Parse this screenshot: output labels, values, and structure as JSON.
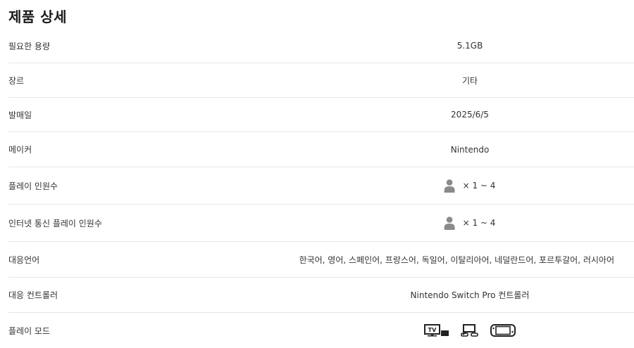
{
  "page": {
    "title": "제품 상세"
  },
  "rows": [
    {
      "label": "필요한 용량",
      "value": "5.1GB"
    },
    {
      "label": "장르",
      "value": "기타"
    },
    {
      "label": "발매일",
      "value": "2025/6/5"
    },
    {
      "label": "메이커",
      "value": "Nintendo"
    },
    {
      "label": "플레이 인원수",
      "value": "× 1 ~ 4",
      "icon": "person-icon"
    },
    {
      "label": "인터넷 통신 플레이 인원수",
      "value": "× 1 ~ 4",
      "icon": "person-icon"
    },
    {
      "label": "대응언어",
      "value": "한국어, 영어, 스페인어, 프랑스어, 독일어, 이탈리아어, 네덜란드어, 포르투갈어, 러시아어"
    },
    {
      "label": "대응 컨트롤러",
      "value": "Nintendo Switch Pro 컨트롤러"
    },
    {
      "label": "플레이 모드",
      "icons": [
        "tv-mode-icon",
        "tabletop-mode-icon",
        "handheld-mode-icon"
      ],
      "tv_text": "TV"
    }
  ],
  "colors": {
    "icon_gray": "#8a8a8a",
    "divider": "#e6e6e6",
    "mode_icon": "#222222"
  }
}
